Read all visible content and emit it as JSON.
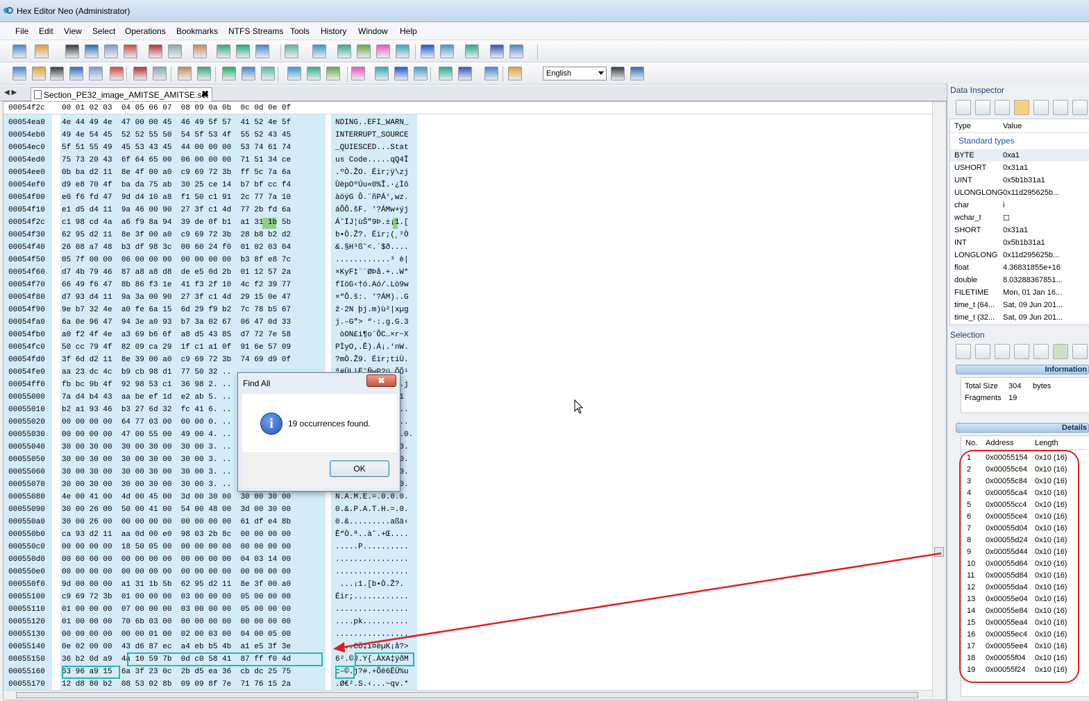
{
  "window": {
    "title": "Hex Editor Neo (Administrator)"
  },
  "menu": [
    "File",
    "Edit",
    "View",
    "Select",
    "Operations",
    "Bookmarks",
    "NTFS Streams",
    "Tools",
    "History",
    "Window",
    "Help"
  ],
  "toolbar": {
    "language": "English"
  },
  "tab": {
    "name": "Section_PE32_image_AMITSE_AMITSE.sct",
    "close": "✖",
    "nav": "◀ ▶"
  },
  "editor": {
    "header_addr": "00054f2c",
    "header_cols": "00 01 02 03  04 05 06 07  08 09 0a 0b  0c 0d 0e 0f",
    "rows": [
      {
        "a": "00054ea0",
        "h": "4e 44 49 4e  47 00 00 45  46 49 5f 57  41 52 4e 5f",
        "s": "NDING..EFI_WARN_"
      },
      {
        "a": "00054eb0",
        "h": "49 4e 54 45  52 52 55 50  54 5f 53 4f  55 52 43 45",
        "s": "INTERRUPT_SOURCE"
      },
      {
        "a": "00054ec0",
        "h": "5f 51 55 49  45 53 43 45  44 00 00 00  53 74 61 74",
        "s": "_QUIESCED...Stat"
      },
      {
        "a": "00054ed0",
        "h": "75 73 20 43  6f 64 65 00  06 00 00 00  71 51 34 ce",
        "s": "us Code.....qQ4Î"
      },
      {
        "a": "00054ee0",
        "h": "0b ba d2 11  8e 4f 00 a0  c9 69 72 3b  ff 5c 7a 6a",
        "s": ".ºÒ.ŽO. Éir;ÿ\\zj"
      },
      {
        "a": "00054ef0",
        "h": "d9 e8 70 4f  ba da 75 ab  30 25 ce 14  b7 bf cc f4",
        "s": "ÙèpOºÚu«0%Î.·¿Ìô"
      },
      {
        "a": "00054f00",
        "h": "e0 f6 fd 47  9d d4 10 a8  f1 50 c1 91  2c 77 7a 10",
        "s": "àöýG Ô.¨ñPÁ‘,wz."
      },
      {
        "a": "00054f10",
        "h": "e1 d5 d4 11  9a 46 00 90  27 3f c1 4d  77 2b fd 6a",
        "s": "áÕÔ.šF. '?ÁMw+ýj"
      },
      {
        "a": "00054f2c",
        "h": "c1 98 cd 4a  a6 f9 8a 94  39 de 0f b1  a1 31 1b 5b",
        "s": "Á˜ÍJ¦ùŠ”9Þ.±¡1.["
      },
      {
        "a": "00054f30",
        "h": "62 95 d2 11  8e 3f 00 a0  c9 69 72 3b  28 b8 b2 d2",
        "s": "b•Ò.Ž?. Éir;(¸²Ò"
      },
      {
        "a": "00054f40",
        "h": "26 08 a7 48  b3 df 98 3c  00 60 24 f0  01 02 03 04",
        "s": "&.§H³ß˜<.`$ð...."
      },
      {
        "a": "00054f50",
        "h": "05 7f 00 00  06 00 00 00  00 00 00 00  b3 8f e8 7c",
        "s": "............³ è|"
      },
      {
        "a": "00054f60",
        "h": "d7 4b 79 46  87 a8 a8 d8  de e5 0d 2b  01 12 57 2a",
        "s": "×KyF‡¨¨ØÞå.+..W*"
      },
      {
        "a": "00054f70",
        "h": "66 49 f6 47  8b 86 f3 1e  41 f3 2f 10  4c f2 39 77",
        "s": "fIöG‹†ó.Aó/.Lò9w"
      },
      {
        "a": "00054f80",
        "h": "d7 93 d4 11  9a 3a 00 90  27 3f c1 4d  29 15 0e 47",
        "s": "×“Ô.š:. '?ÁM)..G"
      },
      {
        "a": "00054f90",
        "h": "9e b7 32 4e  a0 fe 6a 15  6d 29 f9 b2  7c 78 b5 67",
        "s": "ž·2N þj.m)ù²|xµg"
      },
      {
        "a": "00054fa0",
        "h": "6a 0e 96 47  94 3e a0 93  b7 3a 02 67  06 47 0d 33",
        "s": "j.–G”> “·:.g.G.3"
      },
      {
        "a": "00054fb0",
        "h": "a0 f2 4f 4e  a3 69 b6 6f  a8 d5 43 85  d7 72 7e 58",
        "s": " òON£i¶o¨ÕC…×r~X"
      },
      {
        "a": "00054fc0",
        "h": "50 cc 79 4f  82 09 ca 29  1f c1 a1 0f  91 6e 57 09",
        "s": "PÌyO‚.Ê).Á¡.‘nW."
      },
      {
        "a": "00054fd0",
        "h": "3f 6d d2 11  8e 39 00 a0  c9 69 72 3b  74 69 d9 0f",
        "s": "?mÒ.Ž9. Éir;tiÙ."
      },
      {
        "a": "00054fe0",
        "h": "aa 23 dc 4c  b9 cb 98 d1  77 50 32 ..  .. .. .. ..",
        "s": "ª#ÜL¹Ë˜ÑwP2ü.ÕÕ¹"
      },
      {
        "a": "00054ff0",
        "h": "fb bc 9b 4f  92 98 53 c1  36 98 2. ..  .. .. .. ..",
        "s": "û¼›O’˜SÁ6˜.....j"
      },
      {
        "a": "00055000",
        "h": "7a d4 b4 43  aa be ef 1d  e2 ab 5. ..  .. .. .. ..",
        "s": "zÔ´Cª¾ï.â«...Ÿï"
      },
      {
        "a": "00055010",
        "h": "b2 a1 93 46  b3 27 6d 32  fc 41 6. ..  .. .. .. ..",
        "s": "²¡“F³'m2üA......"
      },
      {
        "a": "00055020",
        "h": "00 00 00 00  64 77 03 00  00 00 0. ..  .. .. .. ..",
        "s": "....dw.........."
      },
      {
        "a": "00055030",
        "h": "00 00 00 00  47 00 55 00  49 00 4. ..  .. .. .. ..",
        "s": "....G.U.I.D....0."
      },
      {
        "a": "00055040",
        "h": "30 00 30 00  30 00 30 00  30 00 3. ..  .. .. .. ..",
        "s": "0.0.0.0.0.0.0.0."
      },
      {
        "a": "00055050",
        "h": "30 00 30 00  30 00 30 00  30 00 3. ..  .. .. .. ..",
        "s": "0.0.0.0.0.0.0.0."
      },
      {
        "a": "00055060",
        "h": "30 00 30 00  30 00 30 00  30 00 3. ..  .. .. .. ..",
        "s": "0.0.0.0.0.0.0.0."
      },
      {
        "a": "00055070",
        "h": "30 00 30 00  30 00 30 00  30 00 3. ..  .. .. .. ..",
        "s": "0.0.0.0.0.0.0.0."
      },
      {
        "a": "00055080",
        "h": "4e 00 41 00  4d 00 45 00  3d 00 30 00  30 00 30 00",
        "s": "N.A.M.E.=.0.0.0."
      },
      {
        "a": "00055090",
        "h": "30 00 26 00  50 00 41 00  54 00 48 00  3d 00 30 00",
        "s": "0.&.P.A.T.H.=.0."
      },
      {
        "a": "000550a0",
        "h": "30 00 26 00  00 00 00 00  00 00 00 00  61 df e4 8b",
        "s": "0.&.........aßä‹"
      },
      {
        "a": "000550b0",
        "h": "ca 93 d2 11  aa 0d 00 e0  98 03 2b 8c  00 00 00 00",
        "s": "Ê“Ò.ª..à˜.+Œ...."
      },
      {
        "a": "000550c0",
        "h": "00 00 00 00  18 50 05 00  00 00 00 00  00 00 00 00",
        "s": ".....P.........."
      },
      {
        "a": "000550d0",
        "h": "00 00 00 00  00 00 00 00  00 00 00 00  04 03 14 00",
        "s": "................"
      },
      {
        "a": "000550e0",
        "h": "00 00 00 00  00 00 00 00  00 00 00 00  00 00 00 00",
        "s": "................"
      },
      {
        "a": "000550f0",
        "h": "9d 00 00 00  a1 31 1b 5b  62 95 d2 11  8e 3f 00 a0",
        "s": " ...¡1.[b•Ò.Ž?. "
      },
      {
        "a": "00055100",
        "h": "c9 69 72 3b  01 00 00 00  03 00 00 00  05 00 00 00",
        "s": "Éir;............"
      },
      {
        "a": "00055110",
        "h": "01 00 00 00  07 00 00 00  03 00 00 00  05 00 00 00",
        "s": "................"
      },
      {
        "a": "00055120",
        "h": "01 00 00 00  70 6b 03 00  00 00 00 00  00 00 00 00",
        "s": "....pk.........."
      },
      {
        "a": "00055130",
        "h": "00 00 00 00  00 00 01 00  02 00 03 00  04 00 05 00",
        "s": "................"
      },
      {
        "a": "00055140",
        "h": "0e 02 00 00  43 d6 87 ec  a4 eb b5 4b  a1 e5 3f 3e",
        "s": "....CÖ‡ì¤ëµK¡å?>"
      },
      {
        "a": "00055150",
        "h": "36 b2 0d a9  4a 10 59 7b  0d c0 58 41  87 ff f0 4d",
        "s": "6².©J.Y{.ÀXA‡ÿðM"
      },
      {
        "a": "00055160",
        "h": "63 96 a9 15  6a 3f 23 0c  2b d5 ea 36  cb dc 25 75",
        "s": "c–©.j?#.+Õê6ËÜ%u"
      },
      {
        "a": "00055170",
        "h": "12 d8 80 b2  08 53 02 8b  09 09 8f 7e  71 76 15 2a",
        "s": ".Ø€².S.‹...~qv.*"
      }
    ]
  },
  "dialog": {
    "title": "Find All",
    "close": "✖",
    "message": "19 occurrences found.",
    "ok": "OK",
    "icon": "info-icon"
  },
  "data_inspector": {
    "title": "Data Inspector",
    "col_type": "Type",
    "col_value": "Value",
    "group": "Standard types",
    "rows": [
      {
        "k": "BYTE",
        "v": "0xa1"
      },
      {
        "k": "USHORT",
        "v": "0x31a1"
      },
      {
        "k": "UINT",
        "v": "0x5b1b31a1"
      },
      {
        "k": "ULONGLONG",
        "v": "0x11d295625b..."
      },
      {
        "k": "char",
        "v": "i"
      },
      {
        "k": "wchar_t",
        "v": "☐"
      },
      {
        "k": "SHORT",
        "v": "0x31a1"
      },
      {
        "k": "INT",
        "v": "0x5b1b31a1"
      },
      {
        "k": "LONGLONG",
        "v": "0x11d295625b..."
      },
      {
        "k": "float",
        "v": "4.36831855e+16"
      },
      {
        "k": "double",
        "v": "8.03288367851..."
      },
      {
        "k": "FILETIME",
        "v": "Mon, 01 Jan 16..."
      },
      {
        "k": "time_t (64...",
        "v": "Sat, 09 Jun 201..."
      },
      {
        "k": "time_t (32...",
        "v": "Sat, 09 Jun 201..."
      }
    ]
  },
  "selection": {
    "title": "Selection",
    "info_header": "Information",
    "total_size_label": "Total Size",
    "total_size_value": "304",
    "total_size_unit": "bytes",
    "fragments_label": "Fragments",
    "fragments_value": "19",
    "details_header": "Details",
    "col_no": "No.",
    "col_address": "Address",
    "col_length": "Length",
    "fragments": [
      {
        "n": "1",
        "addr": "0x00055154",
        "len": "0x10 (16)"
      },
      {
        "n": "2",
        "addr": "0x00055c64",
        "len": "0x10 (16)"
      },
      {
        "n": "3",
        "addr": "0x00055c84",
        "len": "0x10 (16)"
      },
      {
        "n": "4",
        "addr": "0x00055ca4",
        "len": "0x10 (16)"
      },
      {
        "n": "5",
        "addr": "0x00055cc4",
        "len": "0x10 (16)"
      },
      {
        "n": "6",
        "addr": "0x00055ce4",
        "len": "0x10 (16)"
      },
      {
        "n": "7",
        "addr": "0x00055d04",
        "len": "0x10 (16)"
      },
      {
        "n": "8",
        "addr": "0x00055d24",
        "len": "0x10 (16)"
      },
      {
        "n": "9",
        "addr": "0x00055d44",
        "len": "0x10 (16)"
      },
      {
        "n": "10",
        "addr": "0x00055d64",
        "len": "0x10 (16)"
      },
      {
        "n": "11",
        "addr": "0x00055d84",
        "len": "0x10 (16)"
      },
      {
        "n": "12",
        "addr": "0x00055da4",
        "len": "0x10 (16)"
      },
      {
        "n": "13",
        "addr": "0x00055e04",
        "len": "0x10 (16)"
      },
      {
        "n": "14",
        "addr": "0x00055e84",
        "len": "0x10 (16)"
      },
      {
        "n": "15",
        "addr": "0x00055ea4",
        "len": "0x10 (16)"
      },
      {
        "n": "16",
        "addr": "0x00055ec4",
        "len": "0x10 (16)"
      },
      {
        "n": "17",
        "addr": "0x00055ee4",
        "len": "0x10 (16)"
      },
      {
        "n": "18",
        "addr": "0x00055f04",
        "len": "0x10 (16)"
      },
      {
        "n": "19",
        "addr": "0x00055f24",
        "len": "0x10 (16)"
      }
    ]
  },
  "colors": {
    "hex_bg": "#d3ecf7",
    "selection_border": "#28b4b4",
    "annotation_red": "#e41d1d",
    "caret_highlight": "#8fd18a"
  }
}
